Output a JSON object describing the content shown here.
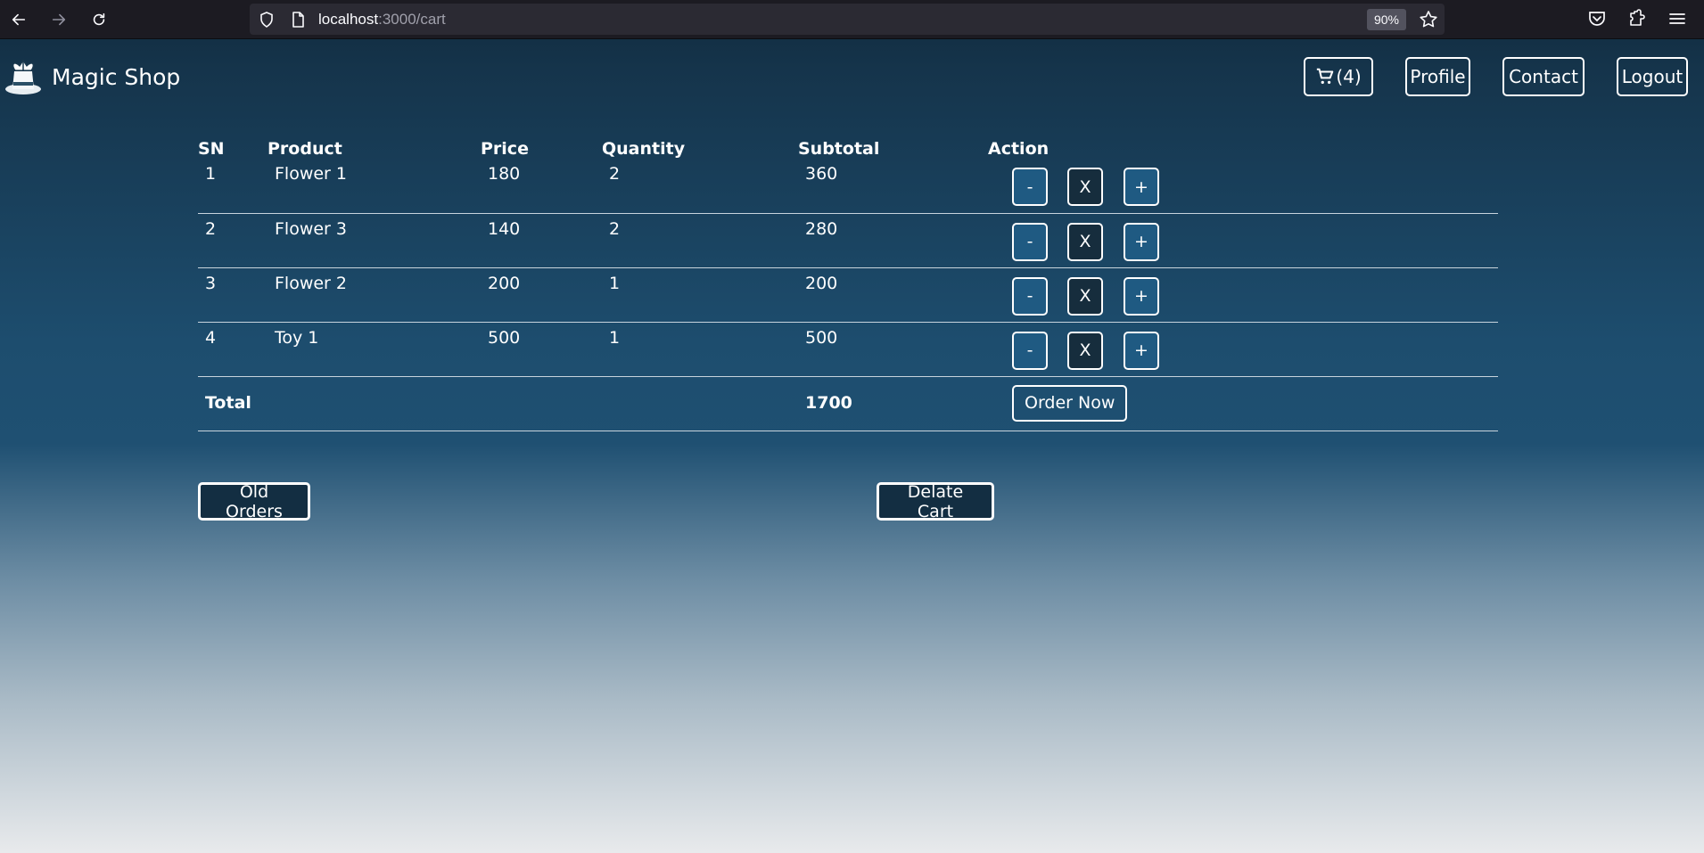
{
  "browser": {
    "url_host": "localhost",
    "url_path": ":3000/cart",
    "zoom": "90%"
  },
  "brand": {
    "name": "Magic Shop"
  },
  "nav": {
    "cart_label": "(4)",
    "profile_label": "Profile",
    "contact_label": "Contact",
    "logout_label": "Logout"
  },
  "table": {
    "headers": [
      "SN",
      "Product",
      "Price",
      "Quantity",
      "Subtotal",
      "Action"
    ],
    "rows": [
      {
        "sn": "1",
        "product": "Flower 1",
        "price": "180",
        "quantity": "2",
        "subtotal": "360"
      },
      {
        "sn": "2",
        "product": "Flower 3",
        "price": "140",
        "quantity": "2",
        "subtotal": "280"
      },
      {
        "sn": "3",
        "product": "Flower 2",
        "price": "200",
        "quantity": "1",
        "subtotal": "200"
      },
      {
        "sn": "4",
        "product": "Toy 1",
        "price": "500",
        "quantity": "1",
        "subtotal": "500"
      }
    ],
    "actions": {
      "decrease": "-",
      "remove": "X",
      "increase": "+"
    },
    "total_label": "Total",
    "total_value": "1700",
    "order_label": "Order Now"
  },
  "buttons": {
    "old_orders": "Old Orders",
    "delete_cart": "Delate Cart"
  }
}
